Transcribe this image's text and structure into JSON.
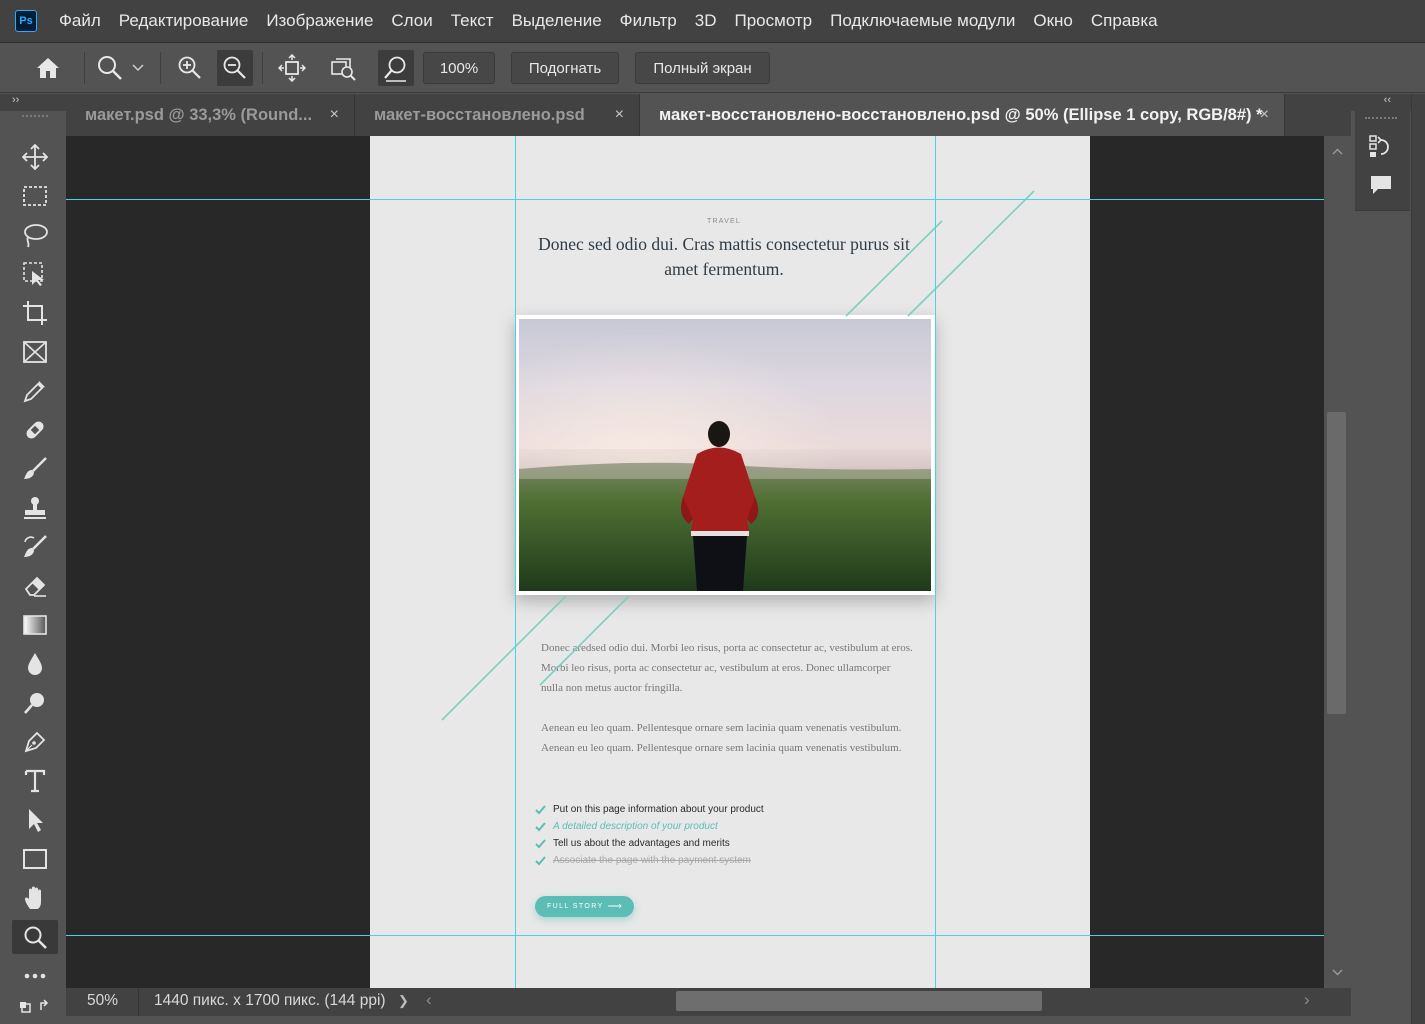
{
  "app": {
    "logo": "Ps"
  },
  "menu": [
    "Файл",
    "Редактирование",
    "Изображение",
    "Слои",
    "Текст",
    "Выделение",
    "Фильтр",
    "3D",
    "Просмотр",
    "Подключаемые модули",
    "Окно",
    "Справка"
  ],
  "options": {
    "zoom_value": "100%",
    "fit_label": "Подогнать",
    "fullscreen_label": "Полный экран"
  },
  "panel_toggles": {
    "left": "››",
    "right": "‹‹"
  },
  "tabs": [
    {
      "label": "макет.psd @ 33,3% (Round...",
      "close": "×",
      "active": false
    },
    {
      "label": "макет-восстановлено.psd",
      "close": "×",
      "active": false
    },
    {
      "label": "макет-восстановлено-восстановлено.psd @ 50% (Ellipse 1 copy, RGB/8#) *",
      "close": "×",
      "active": true
    }
  ],
  "tools": [
    "move-tool",
    "marquee-tool",
    "lasso-tool",
    "object-selection-tool",
    "crop-tool",
    "frame-tool",
    "eyedropper-tool",
    "healing-brush-tool",
    "brush-tool",
    "clone-stamp-tool",
    "history-brush-tool",
    "eraser-tool",
    "gradient-tool",
    "blur-tool",
    "dodge-tool",
    "pen-tool",
    "type-tool",
    "path-selection-tool",
    "rectangle-tool",
    "hand-tool",
    "zoom-tool",
    "more-tools"
  ],
  "document": {
    "label": "TRAVEL",
    "title": "Donec sed odio dui. Cras mattis consectetur purus sit amet fermentum.",
    "paragraph1": "Donec aredsed odio dui. Morbi leo risus, porta ac consectetur ac, vestibulum at eros. Morbi leo risus, porta ac consectetur ac, vestibulum at eros. Donec ullamcorper nulla non metus auctor fringilla.",
    "paragraph2": "Aenean eu leo quam. Pellentesque ornare sem lacinia quam venenatis vestibulum. Aenean eu leo quam. Pellentesque ornare sem lacinia quam venenatis vestibulum.",
    "checklist": [
      {
        "text": "Put on this page information about your product",
        "style": "normal"
      },
      {
        "text": "A detailed description of your product",
        "style": "italic-accent"
      },
      {
        "text": "Tell us about the advantages and merits",
        "style": "normal"
      },
      {
        "text": "Associate the page with the payment system",
        "style": "strikethrough"
      }
    ],
    "cta": "FULL STORY",
    "cta_arrow": "⟶"
  },
  "status": {
    "zoom": "50%",
    "dimensions": "1440 пикс. x 1700 пикс. (144 ppi)",
    "arrow": "❯",
    "left_arrow": "‹",
    "right_arrow": "›"
  },
  "colors": {
    "accent": "#5bbdb6",
    "guide": "#45d6e6",
    "ui_dark": "#424242",
    "ui_mid": "#535353",
    "canvas_bg": "#282828"
  }
}
